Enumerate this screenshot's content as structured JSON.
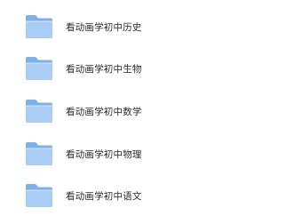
{
  "folders": [
    {
      "name": "看动画学初中历史",
      "icon": "folder-icon"
    },
    {
      "name": "看动画学初中生物",
      "icon": "folder-icon"
    },
    {
      "name": "看动画学初中数学",
      "icon": "folder-icon"
    },
    {
      "name": "看动画学初中物理",
      "icon": "folder-icon"
    },
    {
      "name": "看动画学初中语文",
      "icon": "folder-icon"
    }
  ],
  "colors": {
    "folder_back": "#7fb0e6",
    "folder_front": "#a9cdf5",
    "folder_front_light": "#bcd9f8",
    "text": "#2b2b2b"
  }
}
